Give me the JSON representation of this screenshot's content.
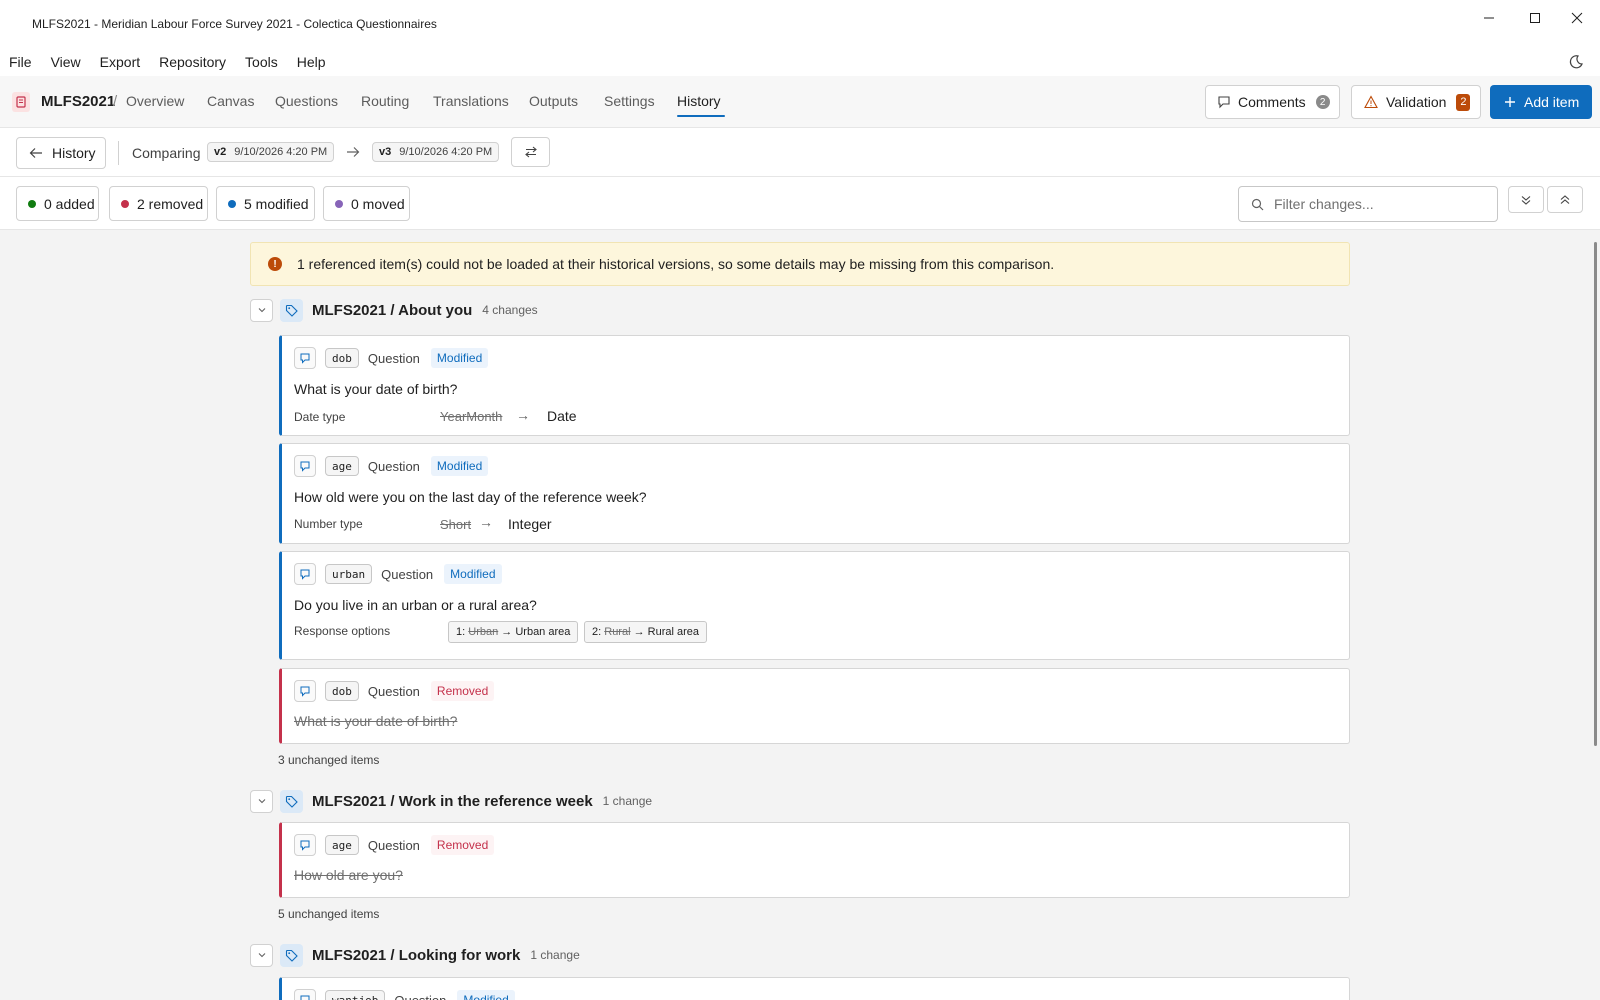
{
  "window": {
    "title": "MLFS2021 - Meridian Labour Force Survey 2021 - Colectica Questionnaires"
  },
  "menu": [
    "File",
    "View",
    "Export",
    "Repository",
    "Tools",
    "Help"
  ],
  "nav": {
    "project": "MLFS2021",
    "separator": "/",
    "overview": "Overview",
    "tabs": [
      "Canvas",
      "Questions",
      "Routing",
      "Translations",
      "Outputs",
      "Settings",
      "History"
    ],
    "active_tab": "History",
    "comments": {
      "label": "Comments",
      "count": "2"
    },
    "validation": {
      "label": "Validation",
      "count": "2"
    },
    "add_item": "Add item"
  },
  "compare": {
    "back_label": "History",
    "comparing_label": "Comparing",
    "from": {
      "version": "v2",
      "date": "9/10/2026 4:20 PM"
    },
    "to": {
      "version": "v3",
      "date": "9/10/2026 4:20 PM"
    }
  },
  "stats": {
    "added": "0 added",
    "removed": "2 removed",
    "modified": "5 modified",
    "moved": "0 moved",
    "colors": {
      "added": "#107c10",
      "removed": "#c4314b",
      "modified": "#0f6cbd",
      "moved": "#8764b8"
    }
  },
  "filter": {
    "placeholder": "Filter changes..."
  },
  "warning": "1 referenced item(s) could not be loaded at their historical versions, so some details may be missing from this comparison.",
  "groups": [
    {
      "title": "MLFS2021 / About you",
      "count": "4 changes",
      "items": [
        {
          "code": "dob",
          "kind": "Question",
          "status": "Modified",
          "text": "What is your date of birth?",
          "prop": "Date type",
          "old": "YearMonth",
          "new": "Date"
        },
        {
          "code": "age",
          "kind": "Question",
          "status": "Modified",
          "text": "How old were you on the last day of the reference week?",
          "prop": "Number type",
          "old": "Short",
          "new": "Integer"
        },
        {
          "code": "urban",
          "kind": "Question",
          "status": "Modified",
          "text": "Do you live in an urban or a rural area?",
          "prop": "Response options",
          "options": [
            {
              "num": "1:",
              "old": "Urban",
              "arrow": "→",
              "new": "Urban area"
            },
            {
              "num": "2:",
              "old": "Rural",
              "arrow": "→",
              "new": "Rural area"
            }
          ]
        },
        {
          "code": "dob",
          "kind": "Question",
          "status": "Removed",
          "text": "What is your date of birth?"
        }
      ],
      "unchanged": "3 unchanged items"
    },
    {
      "title": "MLFS2021 / Work in the reference week",
      "count": "1 change",
      "items": [
        {
          "code": "age",
          "kind": "Question",
          "status": "Removed",
          "text": "How old are you?"
        }
      ],
      "unchanged": "5 unchanged items"
    },
    {
      "title": "MLFS2021 / Looking for work",
      "count": "1 change",
      "items": [
        {
          "code": "wantjob",
          "kind": "Question",
          "status": "Modified"
        }
      ]
    }
  ],
  "colors": {
    "accent": "#0f6cbd",
    "removed": "#c4314b",
    "warning_bg": "#fdf6dc",
    "validation_badge": "#bc4b09"
  }
}
